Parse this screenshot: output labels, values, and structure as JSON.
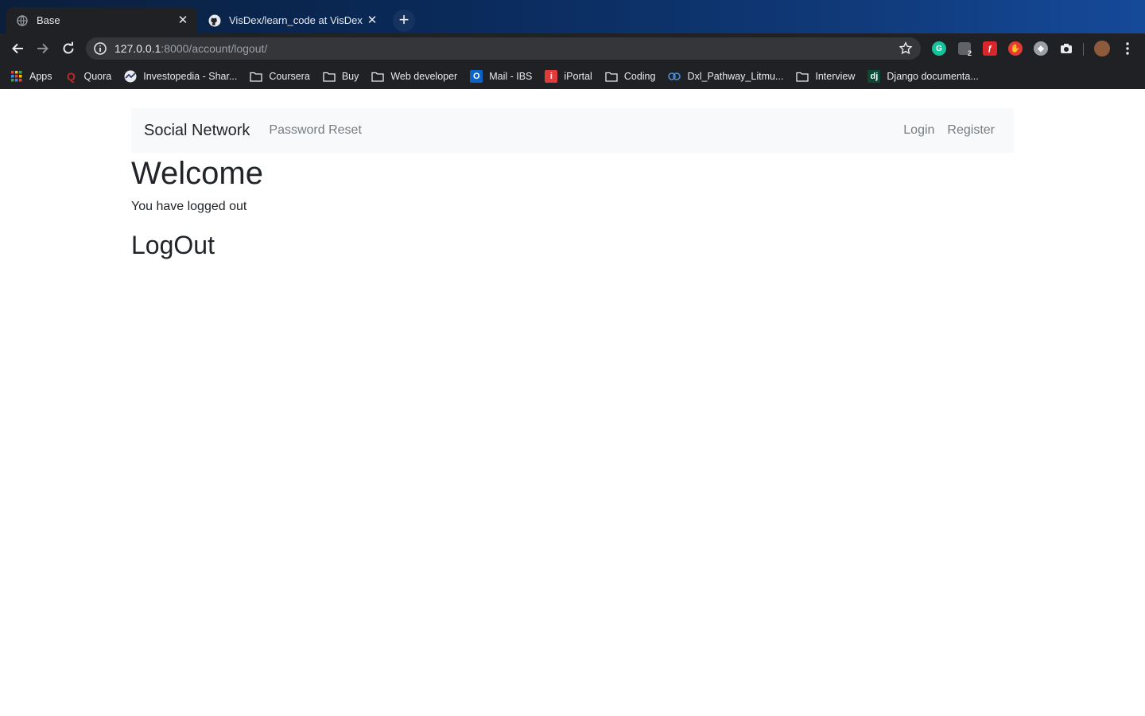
{
  "browser": {
    "tabs": [
      {
        "title": "Base",
        "icon": "globe-icon",
        "active": true
      },
      {
        "title": "VisDex/learn_code at VisDex",
        "icon": "github-icon",
        "active": false
      }
    ],
    "close_glyph": "✕",
    "new_tab_glyph": "+",
    "url": {
      "host": "127.0.0.1",
      "rest": ":8000/account/logout/"
    },
    "ext_badge": "2",
    "bookmarks": [
      {
        "label": "Apps",
        "icon": "apps-grid-icon"
      },
      {
        "label": "Quora",
        "icon": "quora-icon",
        "glyph": "Q",
        "color": "#b92b27"
      },
      {
        "label": "Investopedia - Shar...",
        "icon": "investopedia-icon"
      },
      {
        "label": "Coursera",
        "icon": "folder-icon"
      },
      {
        "label": "Buy",
        "icon": "folder-icon"
      },
      {
        "label": "Web developer",
        "icon": "folder-icon"
      },
      {
        "label": "Mail - IBS",
        "icon": "outlook-icon",
        "glyph": "O",
        "color": "#0a64c8"
      },
      {
        "label": "iPortal",
        "icon": "iportal-icon",
        "glyph": "i",
        "color": "#e03a3a"
      },
      {
        "label": "Coding",
        "icon": "folder-icon"
      },
      {
        "label": "Dxl_Pathway_Litmu...",
        "icon": "pathway-icon"
      },
      {
        "label": "Interview",
        "icon": "folder-icon"
      },
      {
        "label": "Django documenta...",
        "icon": "django-icon",
        "glyph": "dj",
        "color": "#0c4b33"
      }
    ]
  },
  "site": {
    "brand": "Social Network",
    "nav_left": [
      "Password Reset"
    ],
    "nav_right": [
      "Login",
      "Register"
    ],
    "heading": "Welcome",
    "message": "You have logged out",
    "subheading": "LogOut"
  }
}
